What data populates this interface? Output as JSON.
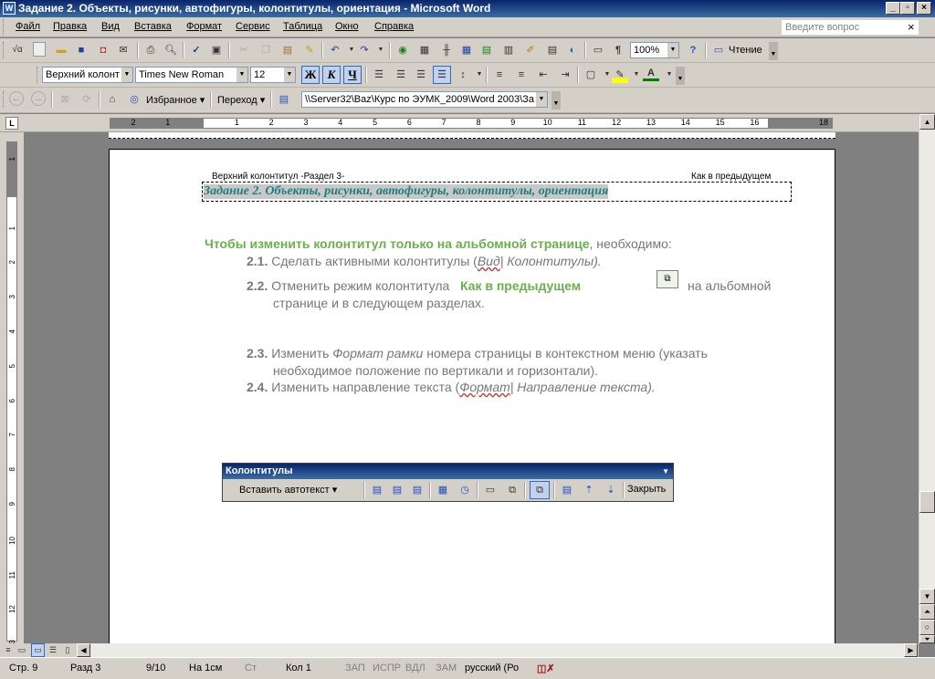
{
  "window": {
    "title": "Задание 2. Объекты, рисунки, автофигуры, колонтитулы, ориентация - Microsoft Word",
    "app_icon": "W"
  },
  "menu": {
    "items": [
      "Файл",
      "Правка",
      "Вид",
      "Вставка",
      "Формат",
      "Сервис",
      "Таблица",
      "Окно",
      "Справка"
    ],
    "ask_placeholder": "Введите вопрос"
  },
  "standard_toolbar": {
    "zoom": "100%",
    "reading_label": "Чтение"
  },
  "format_toolbar": {
    "style": "Верхний колонт",
    "font": "Times New Roman",
    "size": "12",
    "bold": "Ж",
    "italic": "К",
    "underline": "Ч"
  },
  "web_toolbar": {
    "favorites": "Избранное",
    "goto": "Переход",
    "address": "\\\\Server32\\Baz\\Курс по ЭУМК_2009\\Word 2003\\За"
  },
  "ruler": {
    "numbers": [
      "2",
      "1",
      "",
      "1",
      "2",
      "3",
      "4",
      "5",
      "6",
      "7",
      "8",
      "9",
      "10",
      "11",
      "12",
      "13",
      "14",
      "15",
      "16",
      "",
      "18"
    ]
  },
  "vruler": {
    "numbers": [
      "1",
      "",
      "1",
      "2",
      "3",
      "4",
      "5",
      "6",
      "7",
      "8",
      "9",
      "10",
      "11",
      "12",
      "13"
    ]
  },
  "header": {
    "section_label": "Верхний колонтитул -Раздел 3-",
    "same_as_prev": "Как в предыдущем",
    "text": "Задание 2. Объекты, рисунки, автофигуры, колонтитулы, ориентация"
  },
  "body": {
    "intro_bold": "Чтобы изменить колонтитул только на альбомной странице",
    "intro_rest": ", необходимо:",
    "s1_num": "2.1.",
    "s1_a": "Сделать активными колонтитулы (",
    "s1_link": "Вид",
    "s1_b": "| Колонтитулы).",
    "s2_num": "2.2.",
    "s2_a": "Отменить режим колонтитула",
    "s2_bold": "Как в предыдущем",
    "s2_b": "на альбомной",
    "s2_c": "странице и в следующем разделах.",
    "s3_num": "2.3.",
    "s3_a": "Изменить",
    "s3_italic": "Формат рамки",
    "s3_b": "номера страницы в контекстном меню (указать",
    "s3_c": "необходимое положение по вертикали и горизонтали).",
    "s4_num": "2.4.",
    "s4_a": "Изменить направление текста (",
    "s4_link": "Формат",
    "s4_b": "| Направление текста)."
  },
  "hf_toolbar": {
    "title": "Колонтитулы",
    "autotext": "Вставить автотекст",
    "close": "Закрыть"
  },
  "status": {
    "page": "Стр. 9",
    "section": "Разд 3",
    "pages": "9/10",
    "at": "На 1см",
    "line": "Ст",
    "col": "Кол 1",
    "rec": "ЗАП",
    "trk": "ИСПР",
    "ext": "ВДЛ",
    "ovr": "ЗАМ",
    "lang": "русский (Ро"
  },
  "colors": {
    "accent_green": "#6ab04c",
    "header_teal": "#1e7f7f",
    "titlebar": "#0a246a"
  }
}
